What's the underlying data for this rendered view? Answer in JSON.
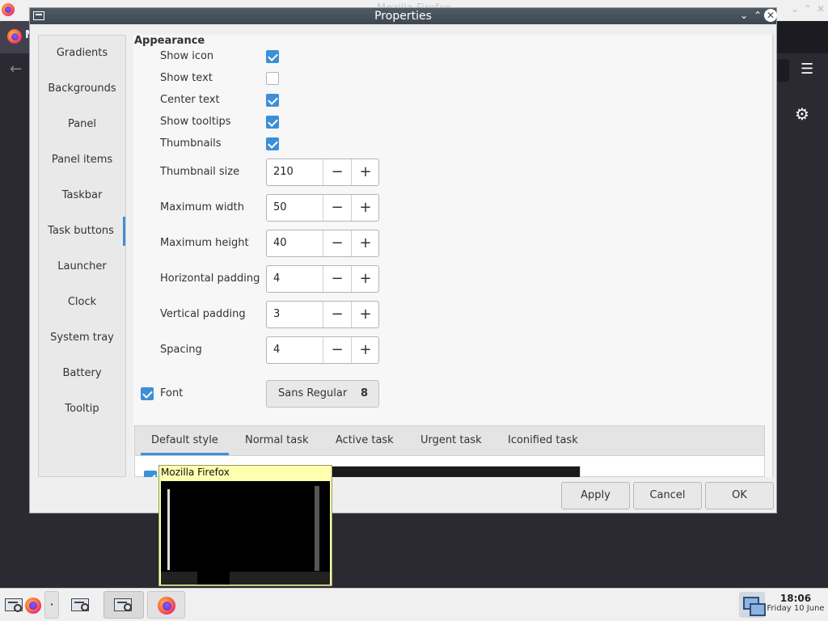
{
  "background_window": {
    "title": "Mozilla Firefox",
    "tab_label": "N"
  },
  "dialog": {
    "title": "Properties",
    "sidebar": {
      "items": [
        {
          "label": "Gradients"
        },
        {
          "label": "Backgrounds"
        },
        {
          "label": "Panel"
        },
        {
          "label": "Panel items"
        },
        {
          "label": "Taskbar"
        },
        {
          "label": "Task buttons",
          "active": true
        },
        {
          "label": "Launcher"
        },
        {
          "label": "Clock"
        },
        {
          "label": "System tray"
        },
        {
          "label": "Battery"
        },
        {
          "label": "Tooltip"
        }
      ]
    },
    "section_title": "Appearance",
    "checkbox_rows": [
      {
        "label": "Show icon",
        "checked": true
      },
      {
        "label": "Show text",
        "checked": false
      },
      {
        "label": "Center text",
        "checked": true
      },
      {
        "label": "Show tooltips",
        "checked": true
      },
      {
        "label": "Thumbnails",
        "checked": true
      }
    ],
    "spin_rows": [
      {
        "label": "Thumbnail size",
        "value": "210"
      },
      {
        "label": "Maximum width",
        "value": "50"
      },
      {
        "label": "Maximum height",
        "value": "40"
      },
      {
        "label": "Horizontal padding",
        "value": "4"
      },
      {
        "label": "Vertical padding",
        "value": "3"
      },
      {
        "label": "Spacing",
        "value": "4"
      }
    ],
    "font_row": {
      "label": "Font",
      "checked": true,
      "font_name": "Sans Regular",
      "font_size": "8"
    },
    "style_tabs": [
      {
        "label": "Default style",
        "active": true
      },
      {
        "label": "Normal task"
      },
      {
        "label": "Active task"
      },
      {
        "label": "Urgent task"
      },
      {
        "label": "Iconified task"
      }
    ],
    "buttons": {
      "apply": "Apply",
      "cancel": "Cancel",
      "ok": "OK"
    },
    "accent_color": "#3d8fd6"
  },
  "tooltip": {
    "title": "Mozilla Firefox"
  },
  "panel": {
    "clock_time": "18:06",
    "clock_date": "Friday 10 June",
    "separator_glyph": "·"
  }
}
